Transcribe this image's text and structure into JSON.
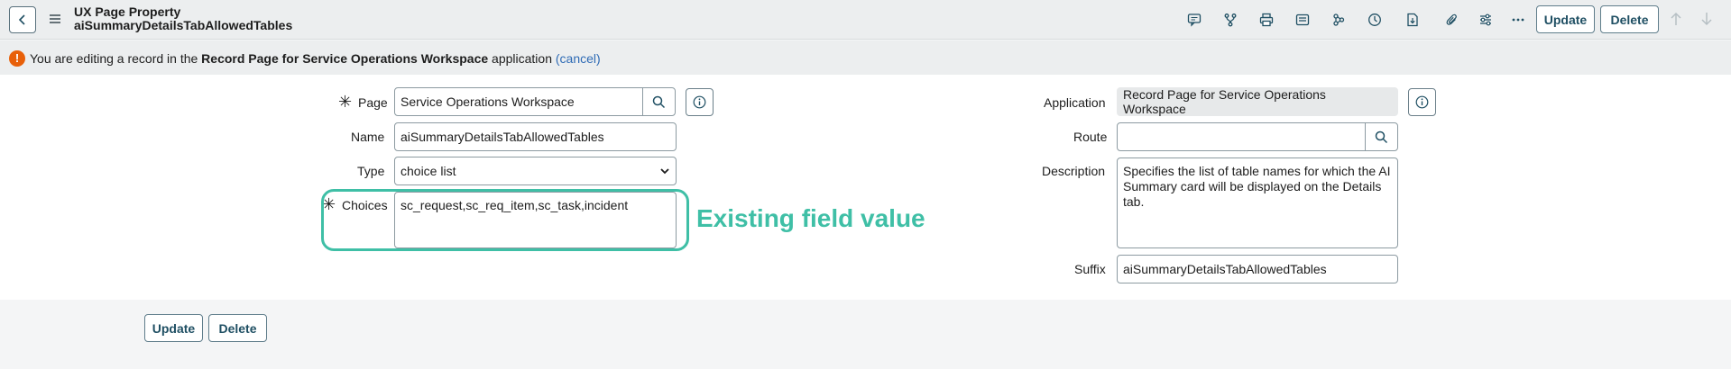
{
  "header": {
    "title_line1": "UX Page Property",
    "title_line2": "aiSummaryDetailsTabAllowedTables",
    "update_label": "Update",
    "delete_label": "Delete"
  },
  "info_bar": {
    "prefix": "You are editing a record in the ",
    "app_name": "Record Page for Service Operations Workspace",
    "suffix": " application ",
    "cancel_label": "(cancel)"
  },
  "form": {
    "page_label": "Page",
    "page_value": "Service Operations Workspace",
    "name_label": "Name",
    "name_value": "aiSummaryDetailsTabAllowedTables",
    "type_label": "Type",
    "type_value": "choice list",
    "choices_label": "Choices",
    "choices_value": "sc_request,sc_req_item,sc_task,incident",
    "application_label": "Application",
    "application_value": "Record Page for Service Operations Workspace",
    "route_label": "Route",
    "route_value": "",
    "description_label": "Description",
    "description_value": "Specifies the list of table names for which the AI Summary card will be displayed on the Details tab.",
    "suffix_label": "Suffix",
    "suffix_value": "aiSummaryDetailsTabAllowedTables",
    "required_mark": "✳"
  },
  "annotation": {
    "text": "Existing field value",
    "color": "#3fbfa6"
  },
  "footer": {
    "update_label": "Update",
    "delete_label": "Delete"
  },
  "colors": {
    "accent": "#1f4f63",
    "warning": "#e8600a",
    "link": "#2f6bb5"
  }
}
